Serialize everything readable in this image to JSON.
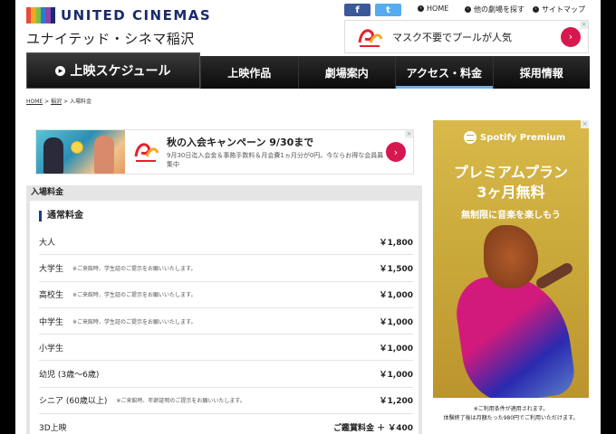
{
  "header": {
    "logo_en": "UNITED CINEMAS",
    "logo_jp": "ユナイテッド・シネマ稲沢",
    "logo_colors": [
      "#e94b3c",
      "#f5a623",
      "#7ac143",
      "#2a7bd1",
      "#8e44ad",
      "#1a2a6c"
    ],
    "social": {
      "facebook": "f",
      "twitter": "t"
    },
    "links": [
      {
        "label": "HOME",
        "icon": "home-icon"
      },
      {
        "label": "他の劇場を探す",
        "icon": "search-icon"
      },
      {
        "label": "サイトマップ",
        "icon": "sitemap-icon"
      }
    ],
    "ad": {
      "text": "マスク不要でプールが人気",
      "go": "›"
    }
  },
  "nav": {
    "items": [
      {
        "label": "上映スケジュール"
      },
      {
        "label": "上映作品"
      },
      {
        "label": "劇場案内"
      },
      {
        "label": "アクセス・料金"
      },
      {
        "label": "採用情報"
      }
    ],
    "active": "アクセス・料金",
    "accent": "#6fb2e6"
  },
  "breadcrumb": {
    "home": "HOME",
    "sep": ">",
    "second": "稲沢",
    "current": "入場料金"
  },
  "banner": {
    "title": "秋の入会キャンペーン 9/30まで",
    "sub": "9月30日迄入会金＆事務手数料＆月会費1ヵ月分が0円。今ならお得な会員募集中",
    "go": "›"
  },
  "prices": {
    "panel_title": "入場料金",
    "section_title": "通常料金",
    "rows": [
      {
        "label": "大人",
        "note": "",
        "price": "￥1,800"
      },
      {
        "label": "大学生",
        "note": "※ご来館時、学生証のご提示をお願いいたします。",
        "price": "￥1,500"
      },
      {
        "label": "高校生",
        "note": "※ご来館時、学生証のご提示をお願いいたします。",
        "price": "￥1,000"
      },
      {
        "label": "中学生",
        "note": "※ご来館時、学生証のご提示をお願いいたします。",
        "price": "￥1,000"
      },
      {
        "label": "小学生",
        "note": "",
        "price": "￥1,000"
      },
      {
        "label": "幼児 (3歳〜6歳)",
        "note": "",
        "price": "￥1,000"
      },
      {
        "label": "シニア (60歳以上)",
        "note": "※ご来館時、年齢証明のご提示をお願いいたします。",
        "price": "￥1,200"
      },
      {
        "label": "3D上映",
        "note": "",
        "price": "ご鑑賞料金 ＋ ￥400"
      }
    ]
  },
  "side_ad": {
    "brand": "Spotify Premium",
    "headline1": "プレミアムプラン",
    "headline2": "3ヶ月無料",
    "sub": "無制限に音楽を楽しもう",
    "foot1": "※ご利用条件が適用されます。",
    "foot2": "体験終了後は月額たった980円でご利用いただけます。"
  }
}
